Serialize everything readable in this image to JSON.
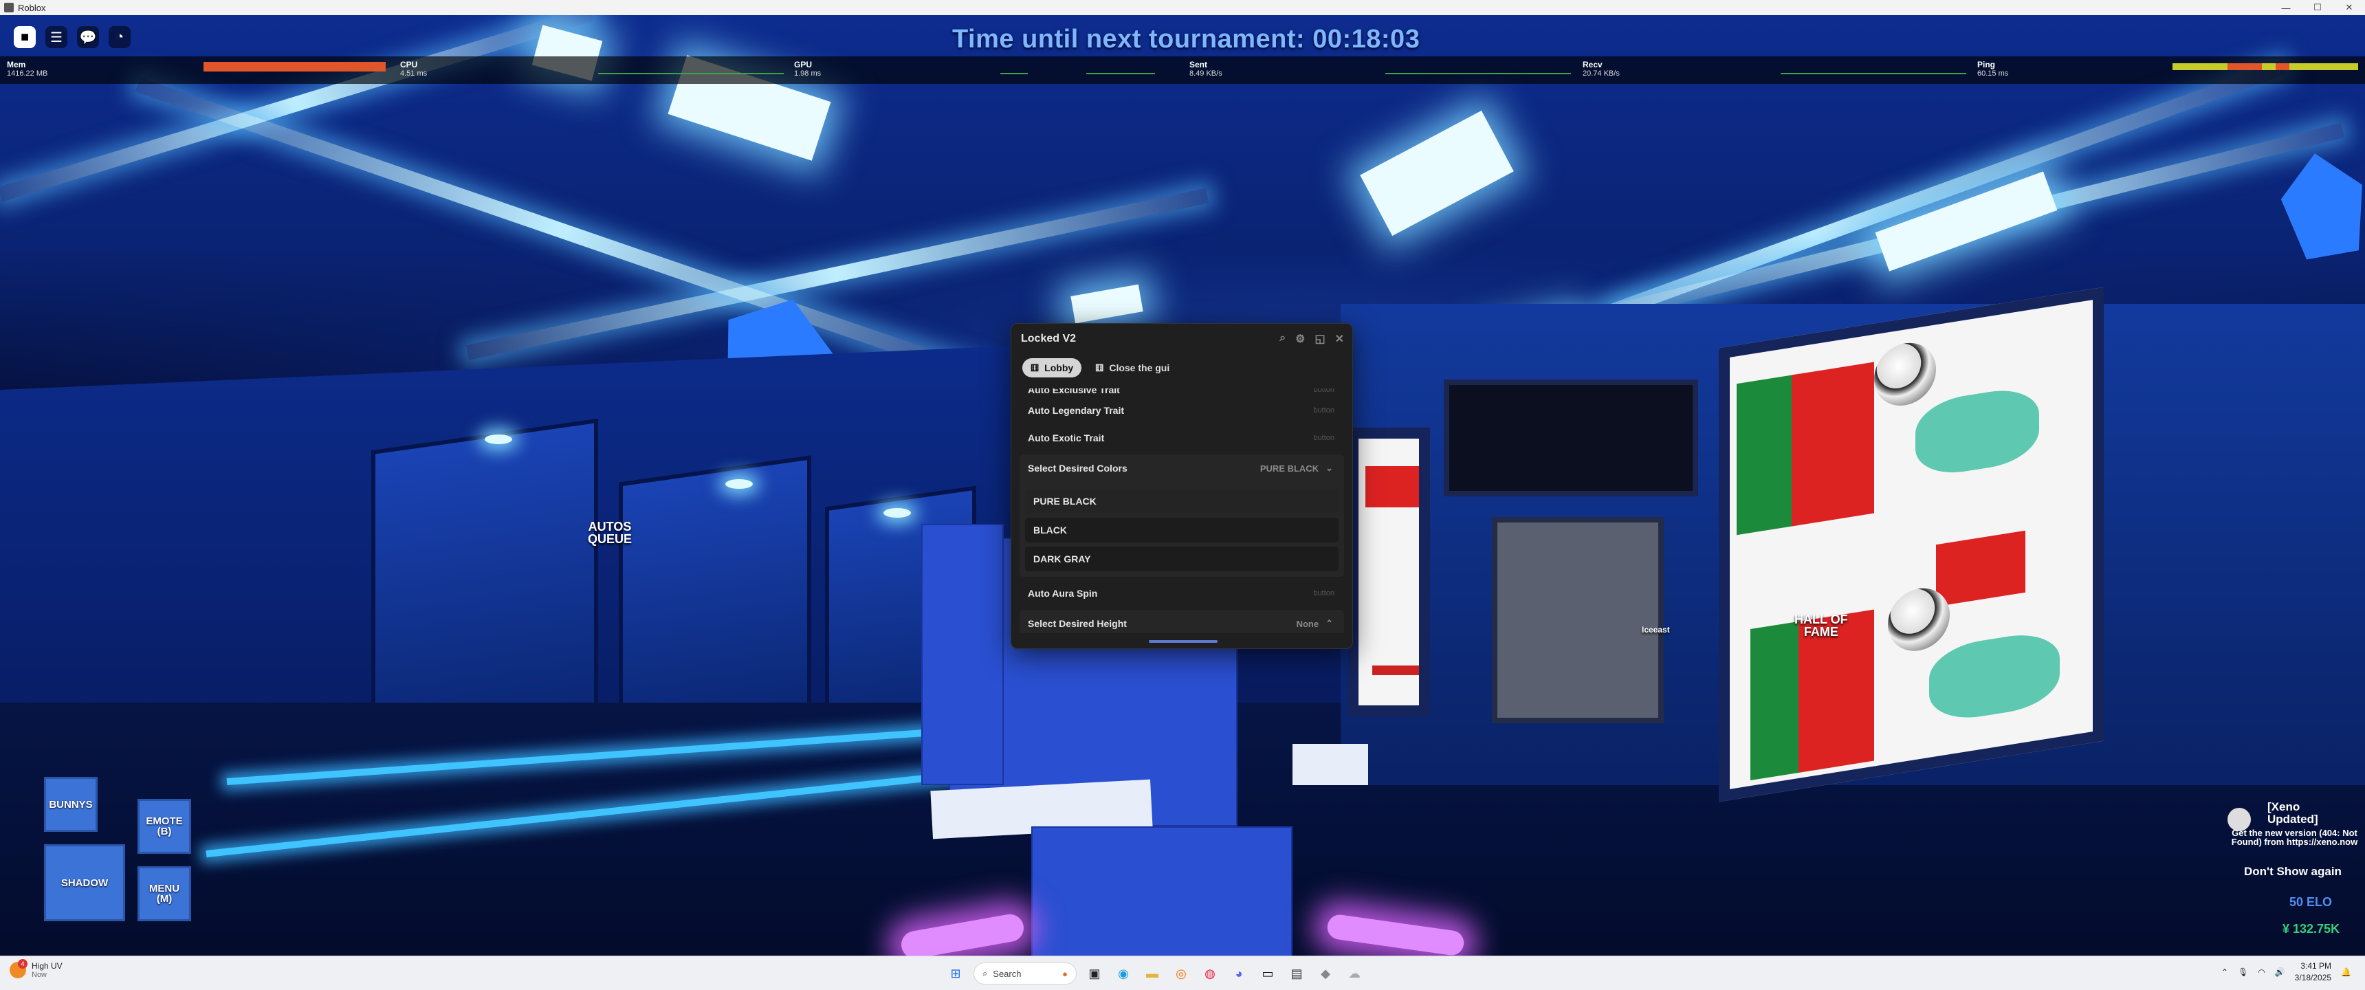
{
  "window": {
    "title": "Roblox",
    "controls": [
      "—",
      "☐",
      "✕"
    ]
  },
  "hud": {
    "tournament": "Time until next tournament: 00:18:03",
    "top_icons": [
      "roblox-icon",
      "menu-icon",
      "chat-icon",
      "performance-icon"
    ]
  },
  "stats": {
    "mem": {
      "label": "Mem",
      "value": "1416.22 MB"
    },
    "cpu": {
      "label": "CPU",
      "value": "4.51 ms"
    },
    "gpu": {
      "label": "GPU",
      "value": "1.98 ms"
    },
    "sent": {
      "label": "Sent",
      "value": "8.49 KB/s"
    },
    "recv": {
      "label": "Recv",
      "value": "20.74 KB/s"
    },
    "ping": {
      "label": "Ping",
      "value": "60.15 ms"
    }
  },
  "world": {
    "autos_queue": "AUTOS\nQUEUE",
    "hall_of_fame": "HALL OF\nFAME",
    "player_name": "Iceeast"
  },
  "panel": {
    "title": "Locked V2",
    "tabs": [
      {
        "label": "Lobby",
        "active": true
      },
      {
        "label": "Close the gui",
        "active": false
      }
    ],
    "rows": {
      "exclusive": "Auto Exclusive Trait",
      "legendary": "Auto Legendary Trait",
      "exotic": "Auto Exotic Trait",
      "button_text": "button"
    },
    "colors_dropdown": {
      "label": "Select Desired Colors",
      "value": "PURE BLACK",
      "options": [
        "PURE BLACK",
        "BLACK",
        "DARK GRAY"
      ]
    },
    "aura_spin": "Auto Aura Spin",
    "height_dropdown": {
      "label": "Select Desired Height",
      "value": "None"
    }
  },
  "game_buttons": {
    "bunnys": "BUNNYS",
    "emote": "EMOTE\n(B)",
    "shadow": "SHADOW",
    "menu": "MENU\n(M)"
  },
  "xeno": {
    "title": "[Xeno\nUpdated]",
    "message": "Get the new version (404: Not Found) from https://xeno.now",
    "dont_show": "Don't Show again"
  },
  "currency": {
    "elo": "50 ELO",
    "money": "¥ 132.75K"
  },
  "taskbar": {
    "weather_badge": "4",
    "weather_title": "High UV",
    "weather_sub": "Now",
    "search_placeholder": "Search",
    "time": "3:41 PM",
    "date": "3/18/2025"
  }
}
